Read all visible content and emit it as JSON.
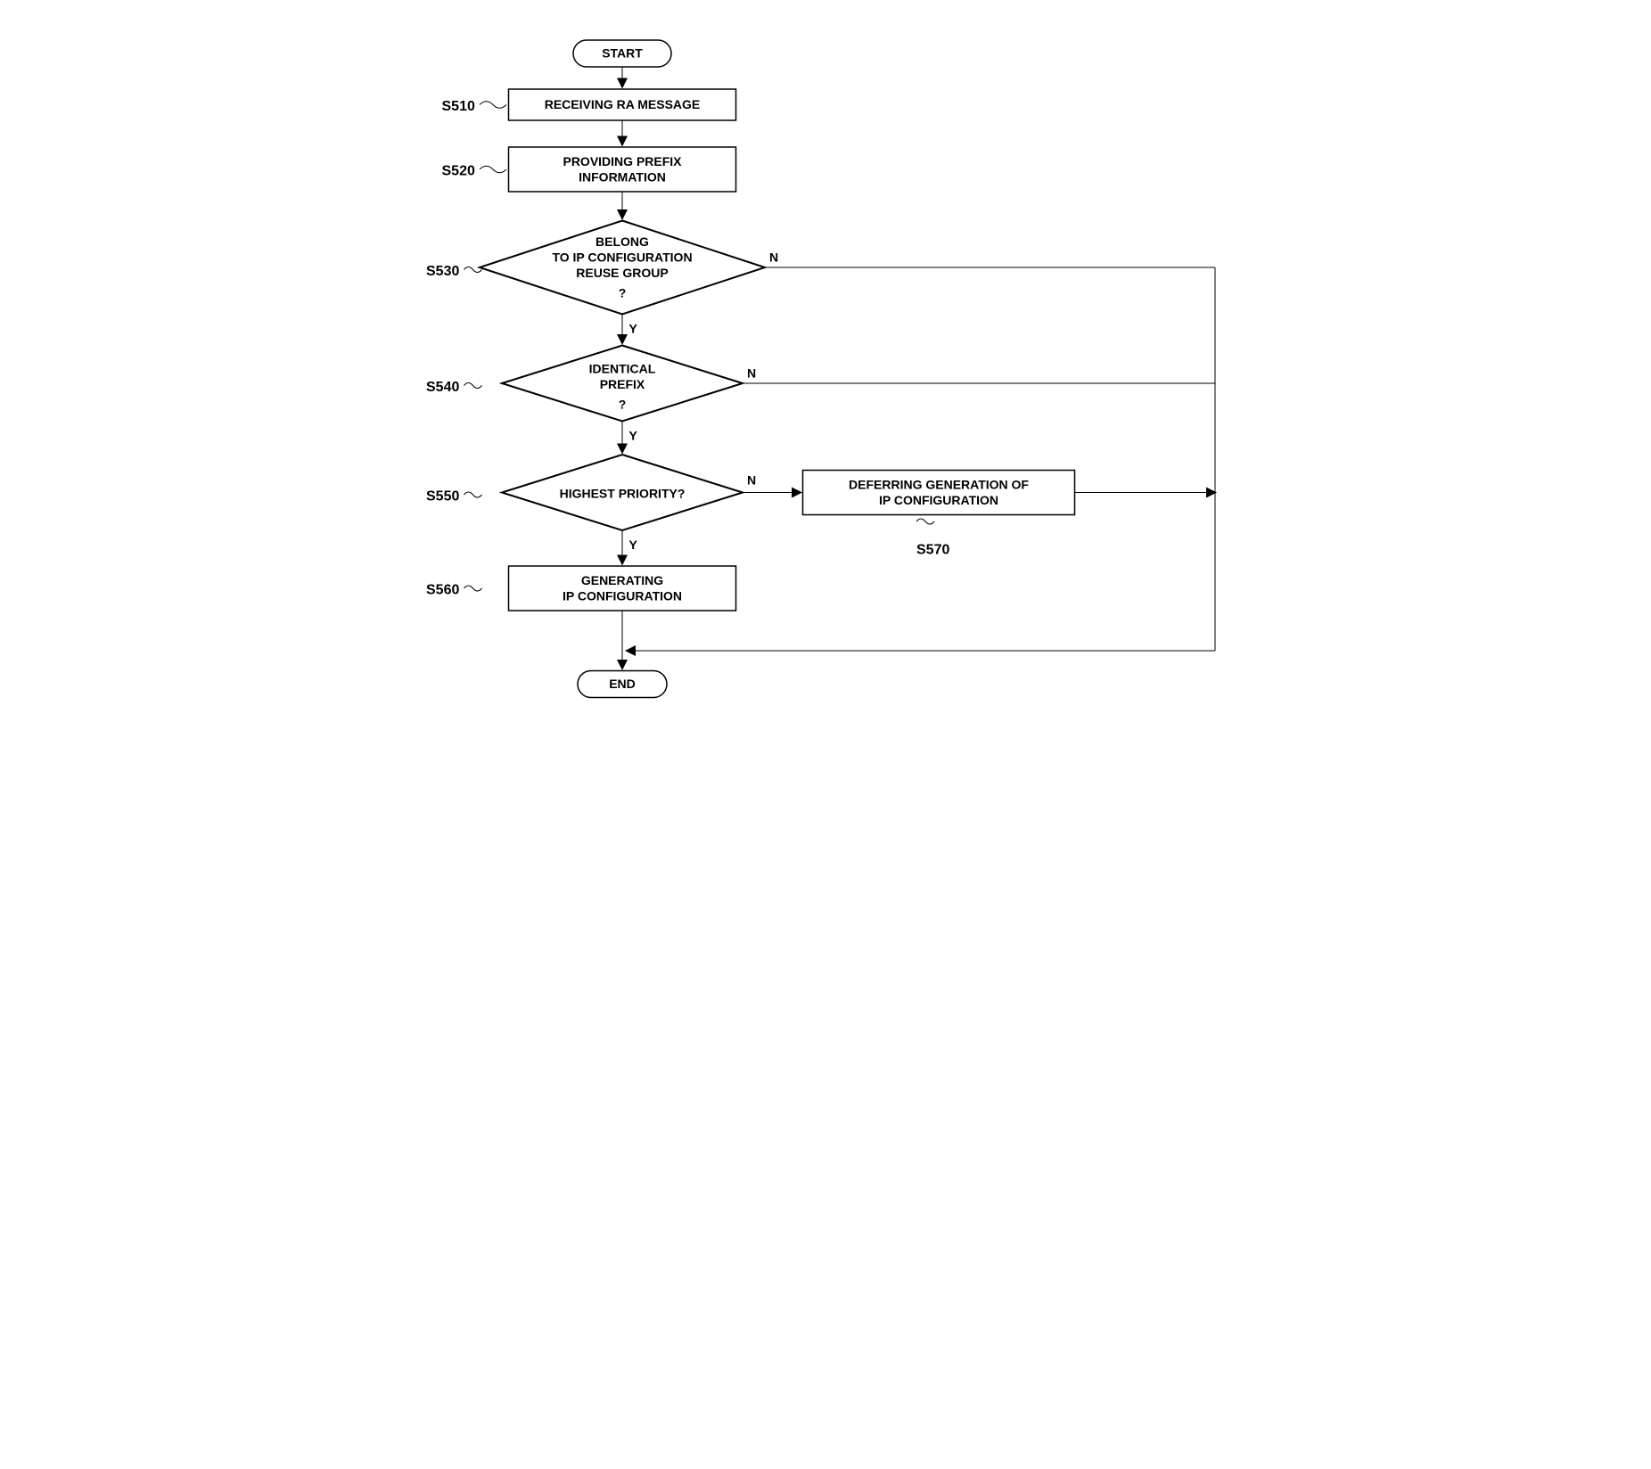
{
  "chart_data": {
    "type": "flowchart",
    "terminals": {
      "start": "START",
      "end": "END"
    },
    "steps": [
      {
        "id": "S510",
        "type": "process",
        "text": "RECEIVING RA MESSAGE",
        "next": "S520"
      },
      {
        "id": "S520",
        "type": "process",
        "text_lines": [
          "PROVIDING PREFIX",
          "INFORMATION"
        ],
        "next": "S530"
      },
      {
        "id": "S530",
        "type": "decision",
        "text_lines": [
          "BELONG",
          "TO IP CONFIGURATION",
          "REUSE GROUP",
          "?"
        ],
        "yes": "S540",
        "no": "END"
      },
      {
        "id": "S540",
        "type": "decision",
        "text_lines": [
          "IDENTICAL",
          "PREFIX",
          "?"
        ],
        "yes": "S550",
        "no": "END"
      },
      {
        "id": "S550",
        "type": "decision",
        "text_lines": [
          "HIGHEST PRIORITY?"
        ],
        "yes": "S560",
        "no": "S570"
      },
      {
        "id": "S560",
        "type": "process",
        "text_lines": [
          "GENERATING",
          "IP CONFIGURATION"
        ],
        "next": "END"
      },
      {
        "id": "S570",
        "type": "process",
        "text_lines": [
          "DEFERRING GENERATION OF",
          "IP CONFIGURATION"
        ],
        "next": "END"
      }
    ],
    "labels": {
      "yes": "Y",
      "no": "N"
    }
  }
}
